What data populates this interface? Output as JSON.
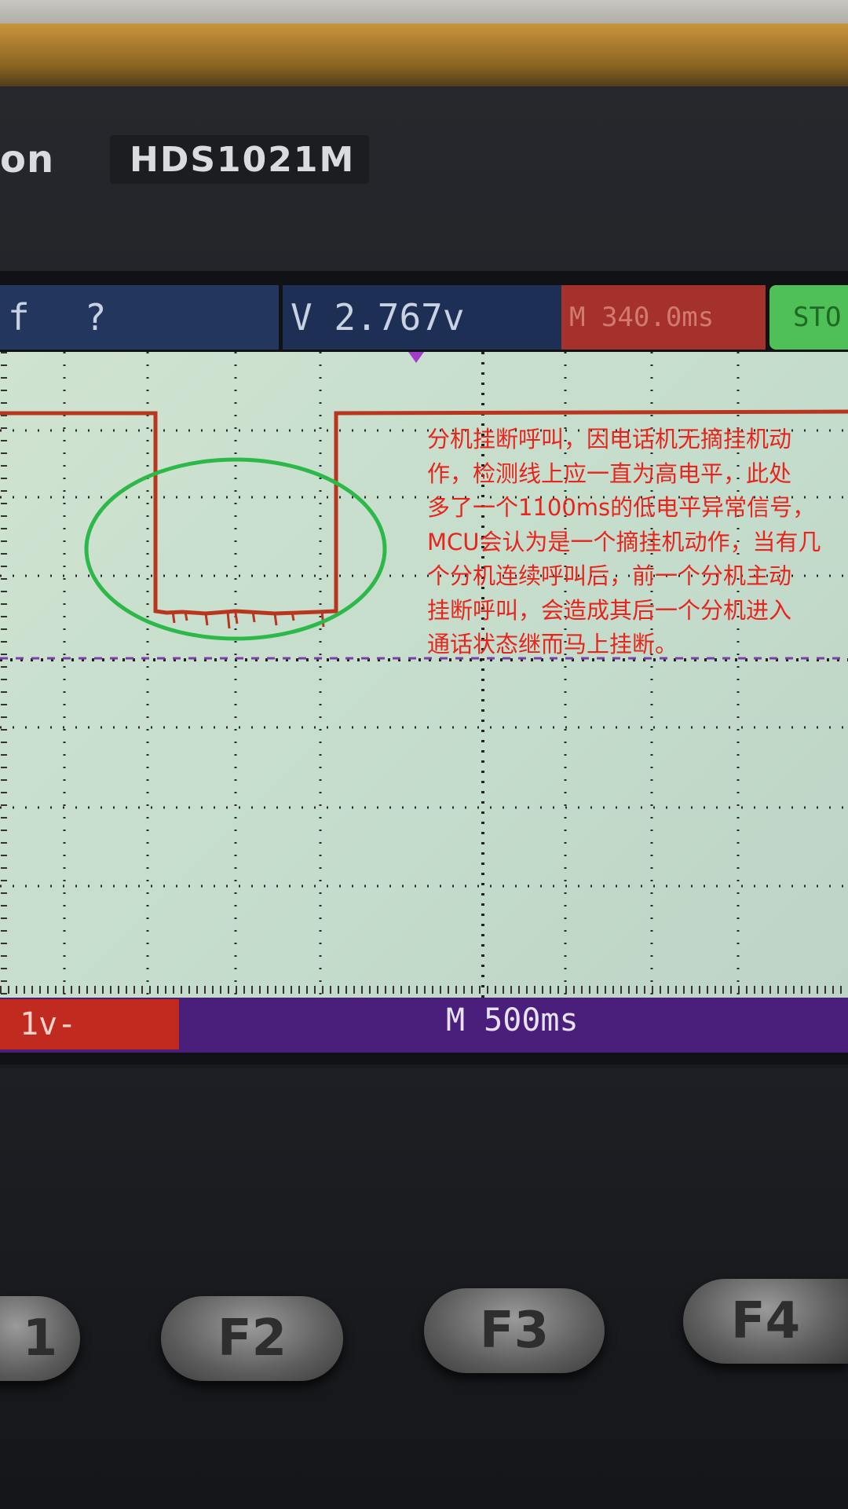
{
  "device": {
    "brand_fragment": "on",
    "model": "HDS1021M"
  },
  "status_bar": {
    "freq_label": "f",
    "freq_value": "?",
    "voltage_readout": "V 2.767v",
    "cursor_time": "M 340.0ms",
    "run_state": "STO"
  },
  "bottom_bar": {
    "channel_scale": "1v-",
    "timebase": "M 500ms"
  },
  "annotation": {
    "text": "分机挂断呼叫，因电话机无摘挂机动作，检测线上应一直为高电平，此处多了一个1100ms的低电平异常信号，MCU会认为是一个摘挂机动作，当有几个分机连续呼叫后，前一个分机主动挂断呼叫，会造成其后一个分机进入通话状态继而马上挂断。",
    "lines": [
      "分机挂断呼叫，因电话机无摘挂机动",
      "作，检测线上应一直为高电平，此处",
      "多了一个1100ms的低电平异常信号，",
      "MCU会认为是一个摘挂机动作，当有几",
      "个分机连续呼叫后，前一个分机主动",
      "挂断呼叫，会造成其后一个分机进入",
      "通话状态继而马上挂断。"
    ],
    "color": "#e8241c",
    "highlight_color": "#2db84a"
  },
  "trace": {
    "color": "#b8361e",
    "low_pulse_duration_ms": 1100
  },
  "function_keys": [
    "1",
    "F2",
    "F3",
    "F4"
  ]
}
